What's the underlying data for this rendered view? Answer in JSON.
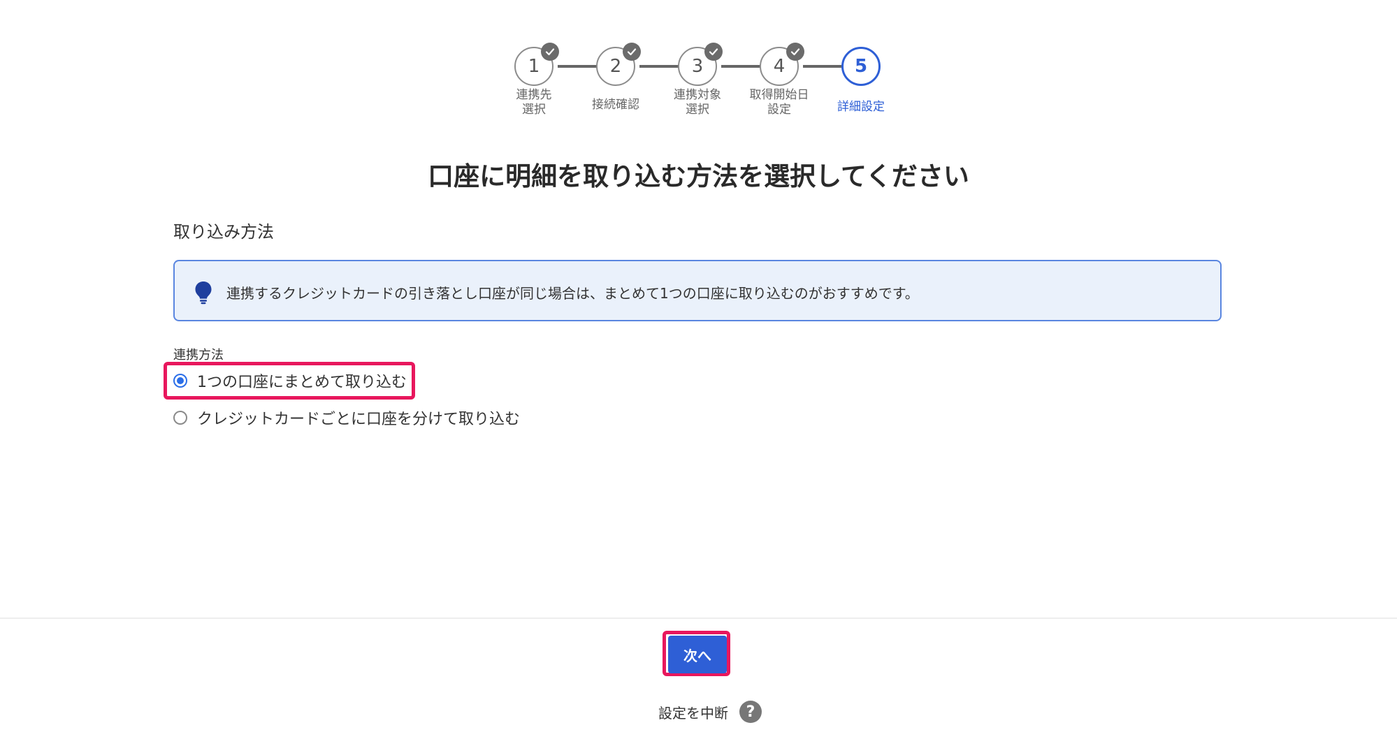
{
  "stepper": {
    "steps": [
      {
        "number": "1",
        "label": "連携先\n選択",
        "done": true
      },
      {
        "number": "2",
        "label": "接続確認",
        "done": true
      },
      {
        "number": "3",
        "label": "連携対象\n選択",
        "done": true
      },
      {
        "number": "4",
        "label": "取得開始日\n設定",
        "done": true
      },
      {
        "number": "5",
        "label": "詳細設定",
        "done": false
      }
    ]
  },
  "page_title": "口座に明細を取り込む方法を選択してください",
  "section_title": "取り込み方法",
  "info": {
    "text": "連携するクレジットカードの引き落とし口座が同じ場合は、まとめて1つの口座に取り込むのがおすすめです。",
    "icon": "lightbulb-icon"
  },
  "field": {
    "label": "連携方法",
    "options": [
      {
        "label": "1つの口座にまとめて取り込む",
        "selected": true
      },
      {
        "label": "クレジットカードごとに口座を分けて取り込む",
        "selected": false
      }
    ]
  },
  "footer": {
    "next_label": "次へ",
    "cancel_label": "設定を中断",
    "help_label": "?"
  },
  "colors": {
    "accent": "#2e5fd6",
    "highlight": "#e8175d",
    "info_bg": "#eaf1fb"
  }
}
